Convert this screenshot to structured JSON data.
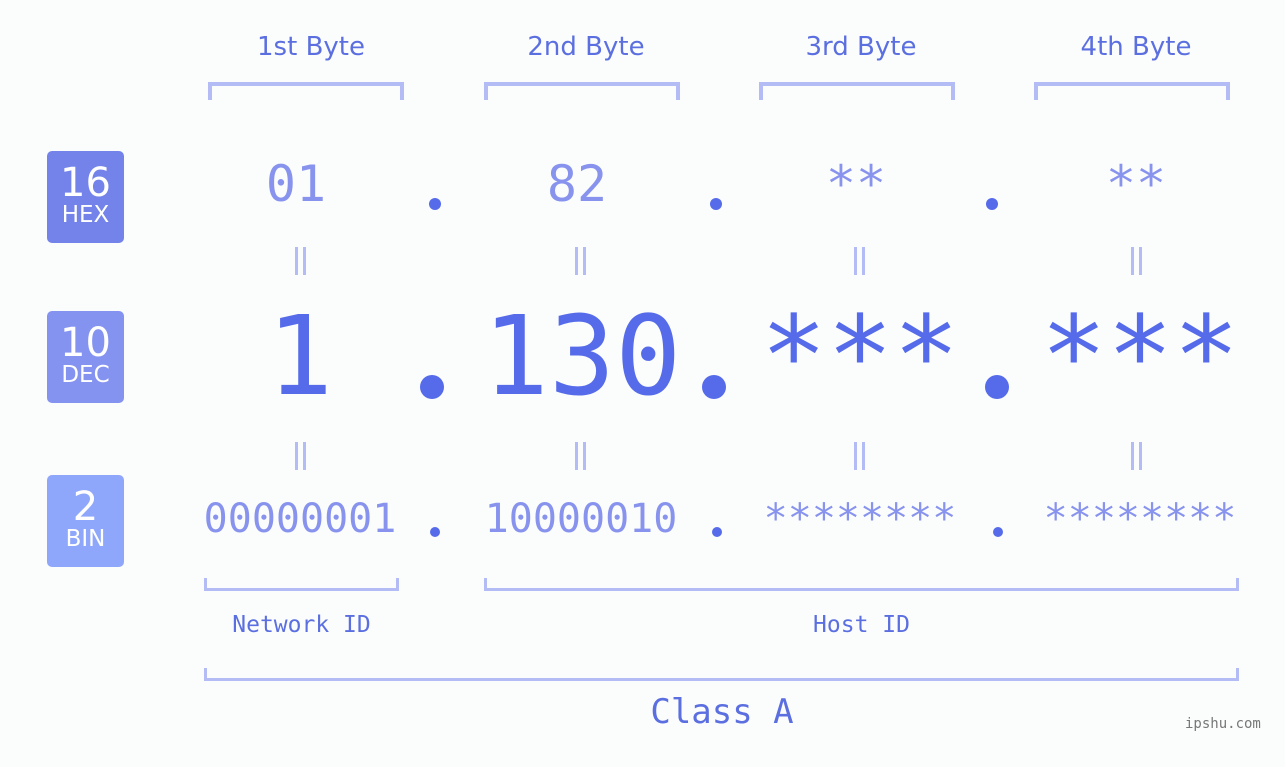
{
  "bytes": [
    {
      "label": "1st Byte",
      "hex": "01",
      "dec": "1",
      "bin": "00000001"
    },
    {
      "label": "2nd Byte",
      "hex": "82",
      "dec": "130",
      "bin": "10000010"
    },
    {
      "label": "3rd Byte",
      "hex": "**",
      "dec": "***",
      "bin": "********"
    },
    {
      "label": "4th Byte",
      "hex": "**",
      "dec": "***",
      "bin": "********"
    }
  ],
  "badges": {
    "hex": {
      "num": "16",
      "label": "HEX",
      "color": "#7383ea"
    },
    "dec": {
      "num": "10",
      "label": "DEC",
      "color": "#8593f0"
    },
    "bin": {
      "num": "2",
      "label": "BIN",
      "color": "#8fa7fa"
    }
  },
  "network_id_label": "Network ID",
  "host_id_label": "Host ID",
  "class_label": "Class A",
  "watermark": "ipshu.com",
  "colors": {
    "primary": "#566bea",
    "secondary": "#8893ee",
    "bracket": "#b3bcf5"
  }
}
